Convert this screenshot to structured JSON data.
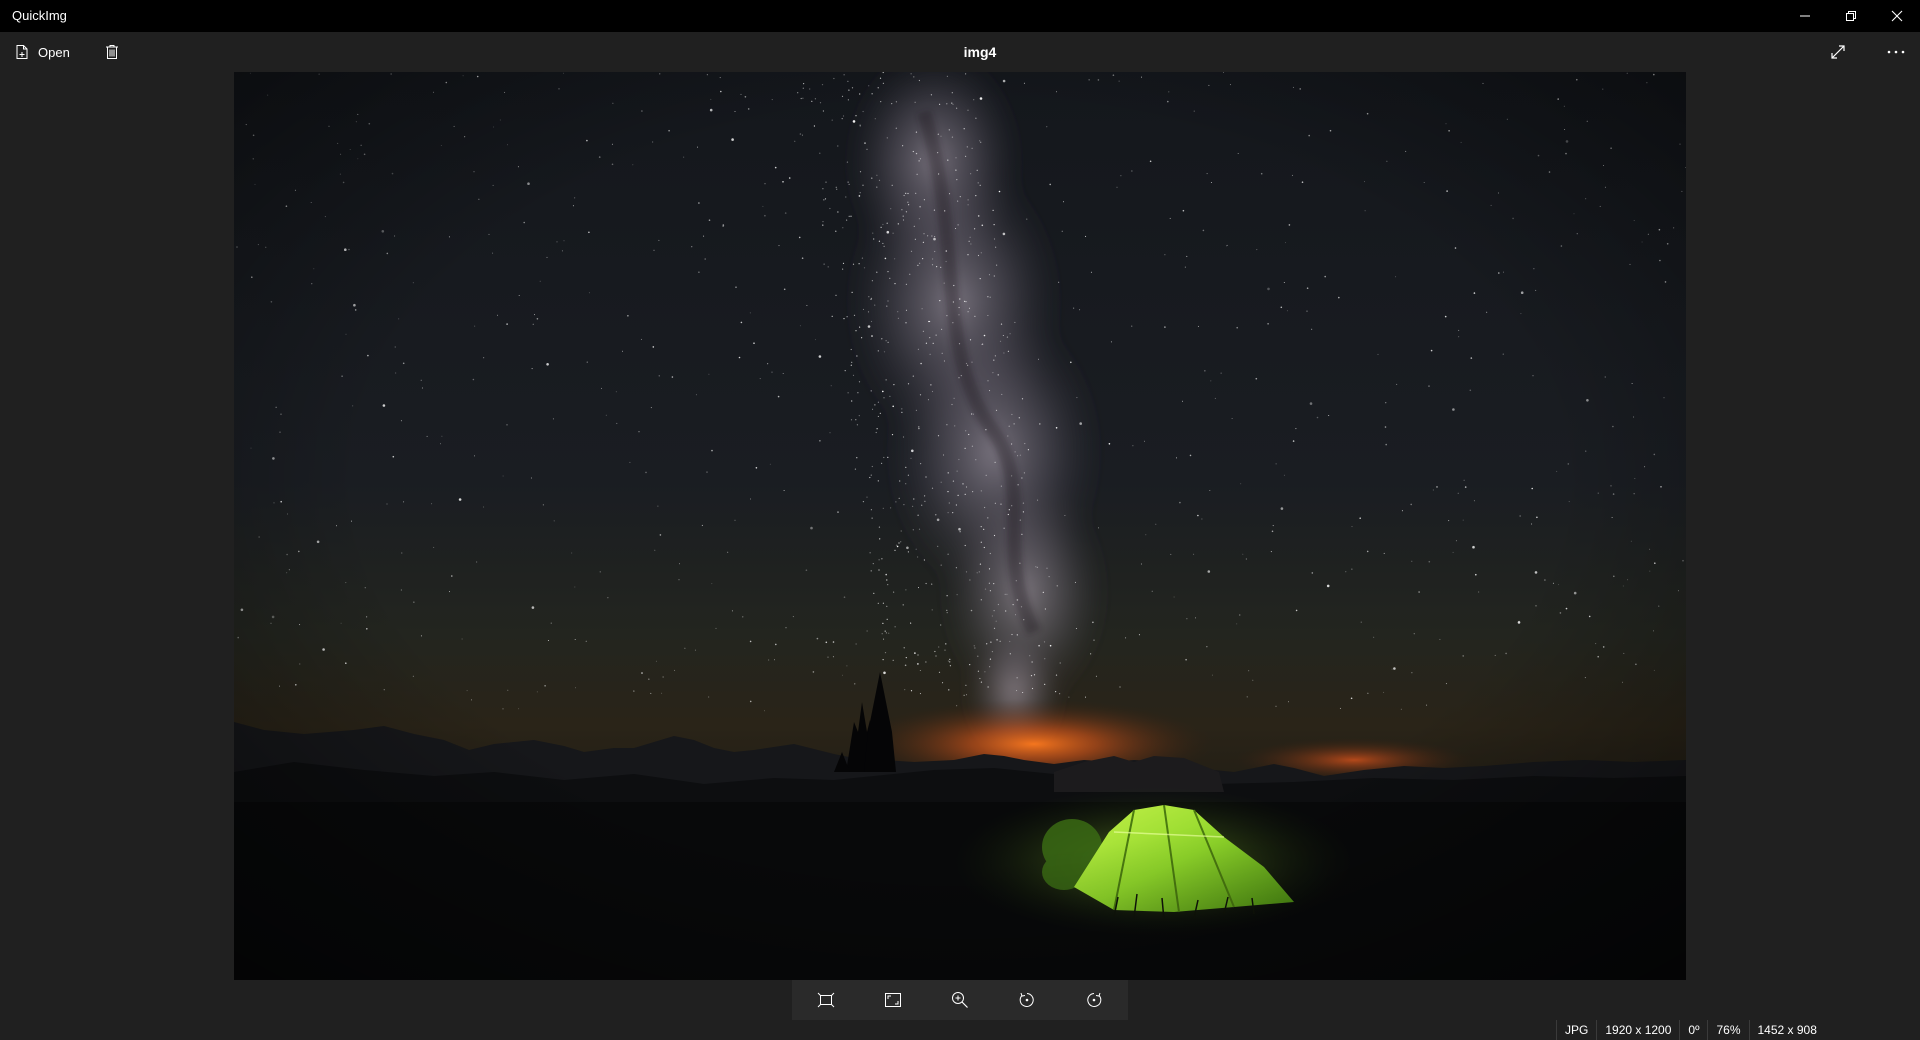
{
  "window": {
    "app_title": "QuickImg",
    "document_title": "img4"
  },
  "commandbar": {
    "open_label": "Open"
  },
  "icons": {
    "open": "file-add-icon",
    "delete": "trash-icon",
    "fullscreen": "expand-diagonal-icon",
    "more": "more-horizontal-icon",
    "minimize": "minimize-icon",
    "restore": "restore-icon",
    "close": "close-icon",
    "fit_window": "fit-to-window-icon",
    "actual_size": "actual-size-icon",
    "zoom_in": "zoom-in-icon",
    "rotate_left": "rotate-left-icon",
    "rotate_right": "rotate-right-icon"
  },
  "statusbar": {
    "format": "JPG",
    "resolution": "1920 x 1200",
    "rotation": "0º",
    "zoom": "76%",
    "display_size": "1452 x 908"
  },
  "colors": {
    "titlebar": "#000000",
    "background": "#202020",
    "toolbar": "#2a2a2a",
    "text": "#ffffff",
    "tent_green": "#8fd62a",
    "horizon_orange": "#e0641a"
  }
}
